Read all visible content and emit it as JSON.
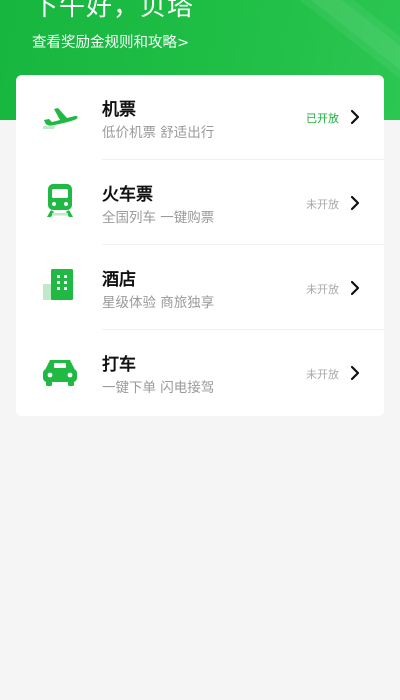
{
  "header": {
    "greeting": "下午好，贝塔",
    "rules_link": "查看奖励金规则和攻略>"
  },
  "services": [
    {
      "title": "机票",
      "subtitle": "低价机票 舒适出行",
      "status": "已开放",
      "icon": "airplane-icon"
    },
    {
      "title": "火车票",
      "subtitle": "全国列车 一键购票",
      "status": "未开放",
      "icon": "train-icon"
    },
    {
      "title": "酒店",
      "subtitle": "星级体验 商旅独享",
      "status": "未开放",
      "icon": "hotel-icon"
    },
    {
      "title": "打车",
      "subtitle": "一键下单 闪电接驾",
      "status": "未开放",
      "icon": "car-icon"
    }
  ],
  "colors": {
    "brand_green": "#1fb943",
    "open_status": "#1fae3e",
    "closed_status": "#a8a8a8",
    "background": "#f5f5f5"
  }
}
